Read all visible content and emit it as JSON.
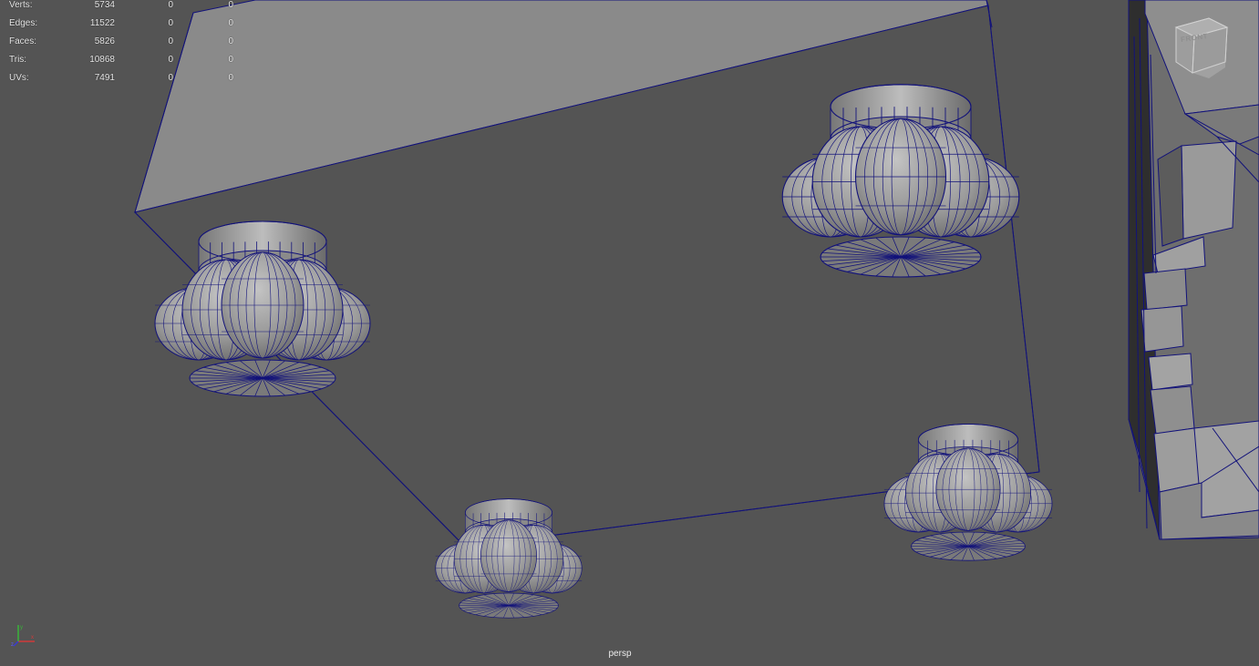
{
  "hud": {
    "rows": [
      {
        "label": "Verts:",
        "v1": "5734",
        "v2": "0",
        "v3": "0"
      },
      {
        "label": "Edges:",
        "v1": "11522",
        "v2": "0",
        "v3": "0"
      },
      {
        "label": "Faces:",
        "v1": "5826",
        "v2": "0",
        "v3": "0"
      },
      {
        "label": "Tris:",
        "v1": "10868",
        "v2": "0",
        "v3": "0"
      },
      {
        "label": "UVs:",
        "v1": "7491",
        "v2": "0",
        "v3": "0"
      }
    ]
  },
  "view_cube": {
    "label": "FRONT"
  },
  "camera": {
    "name": "persp"
  },
  "colors": {
    "background": "#545454",
    "top_face": "#8a8a8a",
    "front_face": "#545454",
    "wireframe": "#12127a",
    "foot_light": "#b5b5b5",
    "foot_mid": "#8c8c8c",
    "foot_dark": "#3a3a3a",
    "text": "#ececec"
  },
  "icons": {
    "axis": "xyz-axis-icon",
    "view_cube": "view-cube-icon"
  }
}
